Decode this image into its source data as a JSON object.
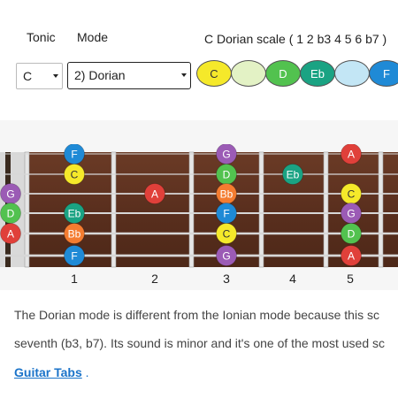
{
  "controls": {
    "tonic_label": "Tonic",
    "mode_label": "Mode",
    "tonic_value": "C",
    "mode_value": "2) Dorian",
    "scale_title": "C Dorian scale ( 1 2 b3 4 5 6 b7 )",
    "scale_notes": [
      {
        "label": "C",
        "color": "#f5e92a"
      },
      {
        "label": "",
        "color": "#e3f2c5"
      },
      {
        "label": "D",
        "color": "#52c24f"
      },
      {
        "label": "Eb",
        "color": "#1aa383"
      },
      {
        "label": "",
        "color": "#c3e6f5"
      },
      {
        "label": "F",
        "color": "#1f8ad6"
      }
    ]
  },
  "fretboard": {
    "fret_numbers": [
      "1",
      "2",
      "3",
      "4",
      "5"
    ],
    "notes": [
      {
        "label": "F",
        "string": 1,
        "fret": 1,
        "color": "#1f8ad6"
      },
      {
        "label": "C",
        "string": 2,
        "fret": 1,
        "color": "#f5e92a"
      },
      {
        "label": "Eb",
        "string": 4,
        "fret": 1,
        "color": "#1aa383"
      },
      {
        "label": "Bb",
        "string": 5,
        "fret": 1,
        "color": "#f47c30"
      },
      {
        "label": "F",
        "string": 6,
        "fret": 1,
        "color": "#1f8ad6"
      },
      {
        "label": "G",
        "string": 3,
        "fret": 0,
        "color": "#9b5bb5"
      },
      {
        "label": "D",
        "string": 4,
        "fret": 0,
        "color": "#52c24f"
      },
      {
        "label": "A",
        "string": 5,
        "fret": 0,
        "color": "#e0403a"
      },
      {
        "label": "A",
        "string": 3,
        "fret": 2,
        "color": "#e0403a"
      },
      {
        "label": "G",
        "string": 1,
        "fret": 3,
        "color": "#9b5bb5"
      },
      {
        "label": "D",
        "string": 2,
        "fret": 3,
        "color": "#52c24f"
      },
      {
        "label": "Bb",
        "string": 3,
        "fret": 3,
        "color": "#f47c30"
      },
      {
        "label": "F",
        "string": 4,
        "fret": 3,
        "color": "#1f8ad6"
      },
      {
        "label": "C",
        "string": 5,
        "fret": 3,
        "color": "#f5e92a"
      },
      {
        "label": "G",
        "string": 6,
        "fret": 3,
        "color": "#9b5bb5"
      },
      {
        "label": "Eb",
        "string": 2,
        "fret": 4,
        "color": "#1aa383"
      },
      {
        "label": "A",
        "string": 1,
        "fret": 5,
        "color": "#e0403a"
      },
      {
        "label": "C",
        "string": 3,
        "fret": 5,
        "color": "#f5e92a"
      },
      {
        "label": "G",
        "string": 4,
        "fret": 5,
        "color": "#9b5bb5"
      },
      {
        "label": "D",
        "string": 5,
        "fret": 5,
        "color": "#52c24f"
      },
      {
        "label": "A",
        "string": 6,
        "fret": 5,
        "color": "#e0403a"
      }
    ]
  },
  "text": {
    "line1": "The Dorian mode is different from the Ionian mode because this sc",
    "line2": "seventh (b3, b7). Its sound is minor and it's one of the most used sc",
    "link_text": "Guitar Tabs",
    "link_after": " ."
  }
}
